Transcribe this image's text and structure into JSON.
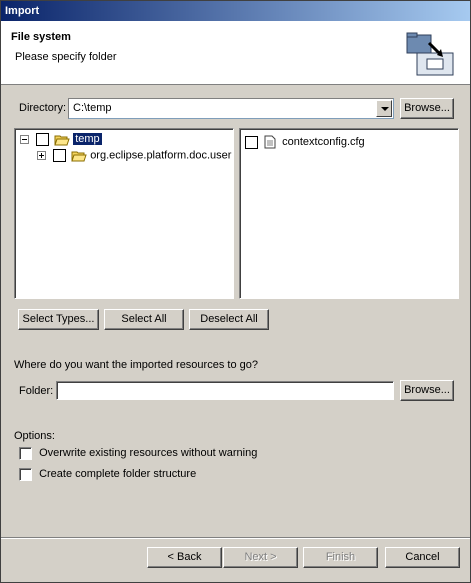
{
  "window": {
    "title": "Import"
  },
  "banner": {
    "title": "File system",
    "message": "Please specify folder",
    "icon": "import-folder-wizard-icon"
  },
  "directory": {
    "label": "Directory:",
    "value": "C:\\temp",
    "browse_label": "Browse..."
  },
  "folder_tree": [
    {
      "label": "temp",
      "expanded": true,
      "selected": true,
      "checked": false,
      "icon": "open-folder-icon"
    },
    {
      "label": "org.eclipse.platform.doc.user",
      "expanded": false,
      "selected": false,
      "checked": false,
      "icon": "open-folder-icon"
    }
  ],
  "file_list": [
    {
      "label": "contextconfig.cfg",
      "checked": false,
      "icon": "text-file-icon"
    }
  ],
  "selection_buttons": {
    "select_types": "Select Types...",
    "select_all": "Select All",
    "deselect_all": "Deselect All"
  },
  "destination": {
    "prompt": "Where do you want the imported resources to go?",
    "folder_label": "Folder:",
    "folder_value": "",
    "browse_label": "Browse..."
  },
  "options": {
    "heading": "Options:",
    "overwrite": {
      "label": "Overwrite existing resources without warning",
      "checked": false
    },
    "create_structure": {
      "label": "Create complete folder structure",
      "checked": false
    }
  },
  "footer": {
    "back": "< Back",
    "next": "Next >",
    "finish": "Finish",
    "cancel": "Cancel"
  }
}
